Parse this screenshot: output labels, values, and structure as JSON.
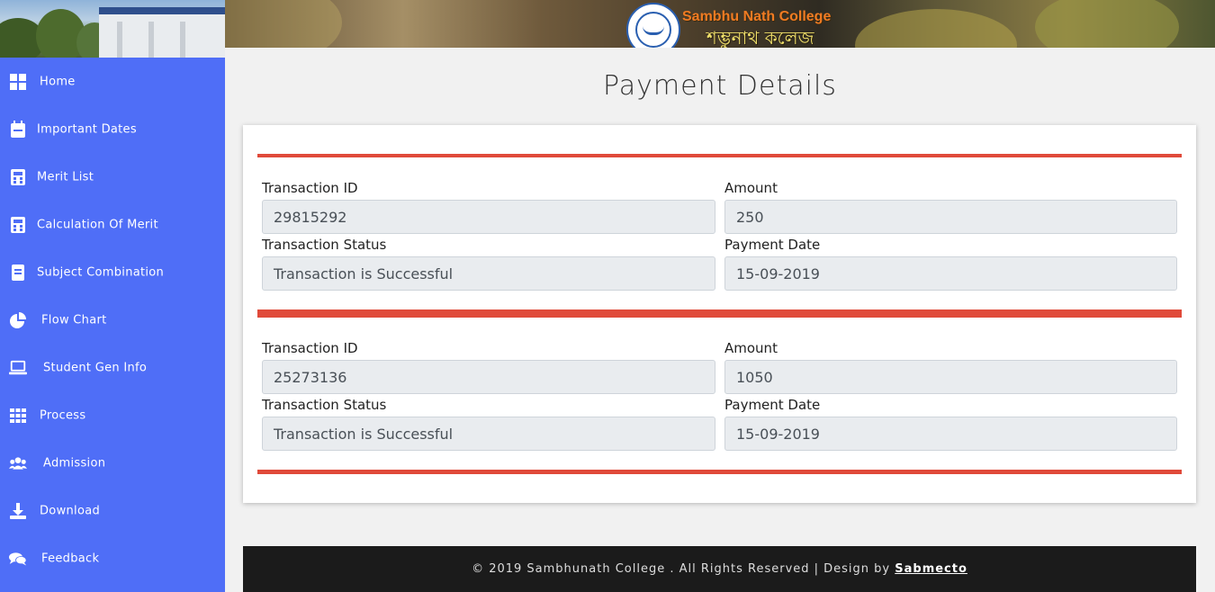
{
  "header": {
    "brand_en": "Sambhu Nath College",
    "brand_bn": "শম্ভুনাথ কলেজ",
    "logo_icon": "college-seal-icon"
  },
  "sidebar": {
    "items": [
      {
        "label": "Home",
        "icon": "grid-icon"
      },
      {
        "label": "Important Dates",
        "icon": "calendar-icon"
      },
      {
        "label": "Merit List",
        "icon": "calculator-icon"
      },
      {
        "label": "Calculation Of Merit",
        "icon": "calculator-icon"
      },
      {
        "label": "Subject Combination",
        "icon": "book-icon"
      },
      {
        "label": "Flow Chart",
        "icon": "pie-chart-icon"
      },
      {
        "label": "Student Gen Info",
        "icon": "laptop-icon"
      },
      {
        "label": "Process",
        "icon": "grid-nine-icon"
      },
      {
        "label": "Admission",
        "icon": "users-icon"
      },
      {
        "label": "Download",
        "icon": "download-icon"
      },
      {
        "label": "Feedback",
        "icon": "comments-icon"
      }
    ]
  },
  "page": {
    "title": "Payment Details"
  },
  "payments": [
    {
      "transaction_id_label": "Transaction ID",
      "transaction_id": "29815292",
      "amount_label": "Amount",
      "amount": "250",
      "status_label": "Transaction Status",
      "status": "Transaction is Successful",
      "date_label": "Payment Date",
      "date": "15-09-2019"
    },
    {
      "transaction_id_label": "Transaction ID",
      "transaction_id": "25273136",
      "amount_label": "Amount",
      "amount": "1050",
      "status_label": "Transaction Status",
      "status": "Transaction is Successful",
      "date_label": "Payment Date",
      "date": "15-09-2019"
    }
  ],
  "footer": {
    "text": "© 2019 Sambhunath College . All Rights Reserved | Design by",
    "link": "Sabmecto"
  },
  "colors": {
    "sidebar": "#4f6ef7",
    "accent_rule": "#e04a3a",
    "footer": "#1b1b1b"
  }
}
